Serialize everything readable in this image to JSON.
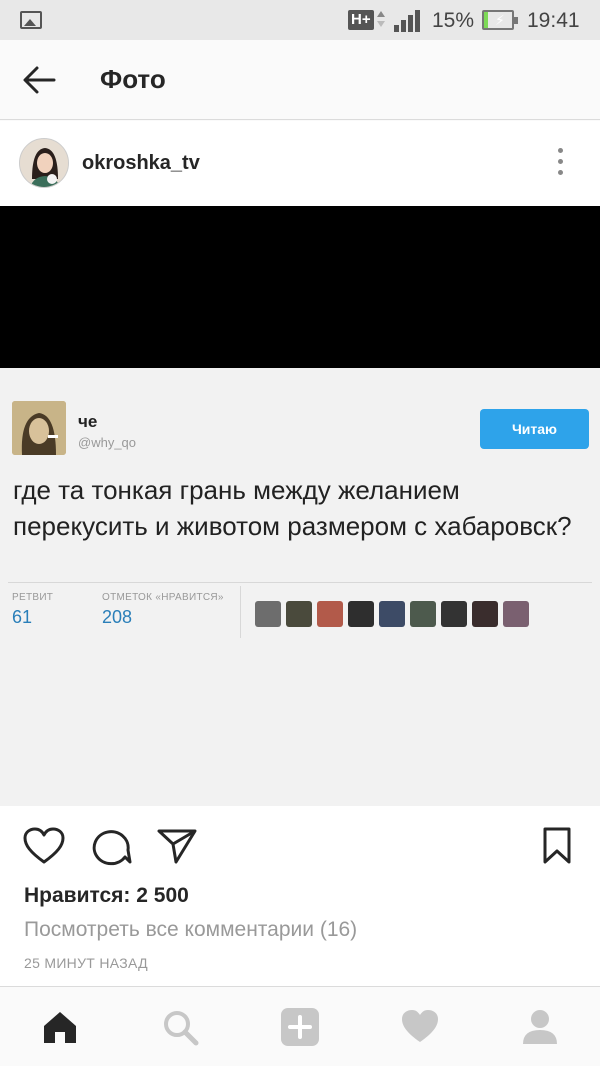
{
  "status_bar": {
    "network": "H+",
    "battery_percent": "15%",
    "battery_level": 0.15,
    "time": "19:41",
    "icons": [
      "gallery-icon",
      "data-arrows-icon",
      "signal-icon",
      "battery-charging-icon"
    ]
  },
  "header": {
    "title": "Фото",
    "back_icon": "arrow-left-icon"
  },
  "post": {
    "username": "okroshka_tv",
    "more_icon": "more-vertical-icon"
  },
  "tweet": {
    "name": "че",
    "handle": "@why_qo",
    "follow_label": "Читаю",
    "text": "где та тонкая грань между желанием перекусить и животом размером с хабаровск?",
    "retweets_label": "РЕТВИТ",
    "retweets_value": "61",
    "likes_label": "ОТМЕТОК «НРАВИТСЯ»",
    "likes_value": "208",
    "likers_count_shown": 9,
    "colors": {
      "follow_button": "#2ea3ea",
      "stat_value": "#2a7fb9"
    }
  },
  "actions": {
    "icons": [
      "heart-icon",
      "comment-icon",
      "share-icon",
      "bookmark-icon"
    ],
    "likes_text": "Нравится: 2 500",
    "view_comments": "Посмотреть все комментарии (16)",
    "time_ago": "25 МИНУТ НАЗАД"
  },
  "bottom_nav": {
    "items": [
      "home-icon",
      "search-icon",
      "add-icon",
      "activity-heart-icon",
      "profile-icon"
    ]
  }
}
